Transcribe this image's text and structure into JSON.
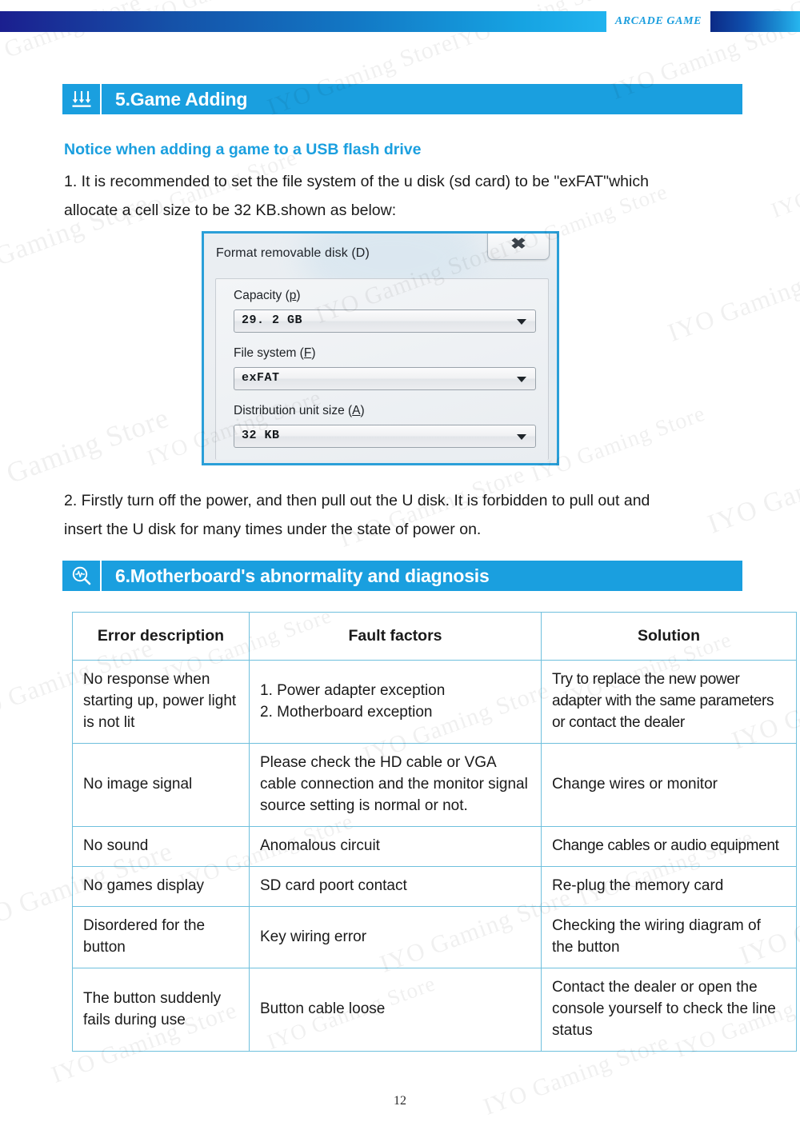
{
  "banner": {
    "label": "ARCADE GAME",
    "accent_color": "#1b9ede",
    "gradient_from": "#1b1f8f",
    "gradient_to": "#27b6ef"
  },
  "sections": [
    {
      "icon": "download-arrows-icon",
      "title": "5.Game Adding"
    },
    {
      "icon": "magnifier-diagnostic-icon",
      "title": "6.Motherboard's abnormality and diagnosis"
    }
  ],
  "section5": {
    "subheading": "Notice when adding a game to a USB flash drive",
    "paragraph1_line1": "1. It is recommended to set the file system of the u disk (sd card) to be \"exFAT\"which",
    "paragraph1_line2": "allocate a cell size to be 32 KB.shown as below:",
    "paragraph2_line1": "2. Firstly turn off the power, and then pull out the U disk. It is forbidden to pull out and",
    "paragraph2_line2": "insert the U disk for many times under the state of power on."
  },
  "format_dialog": {
    "title": "Format removable disk (D)",
    "close_label": "✖",
    "fields": [
      {
        "label": "Capacity (",
        "accel": "p",
        "label_end": ")",
        "value": "29. 2  GB"
      },
      {
        "label": "File system (",
        "accel": "F",
        "label_end": ")",
        "value": "exFAT"
      },
      {
        "label": "Distribution unit size (",
        "accel": "A",
        "label_end": ")",
        "value": "32  KB"
      }
    ],
    "border_color": "#2a9fd8"
  },
  "diagnosis_table": {
    "headers": [
      "Error description",
      "Fault factors",
      "Solution"
    ],
    "border_color": "#6fc0dd",
    "rows": [
      {
        "error": "No response when starting up, power light is not lit",
        "fault": "1. Power adapter exception\n2.  Motherboard exception",
        "solution": "Try to replace the new power adapter with the same parameters or contact the dealer"
      },
      {
        "error": "No image signal",
        "fault": "Please check the HD cable or VGA cable connection and the monitor signal source setting is normal or not.",
        "solution": "Change wires or monitor"
      },
      {
        "error": "No sound",
        "fault": "Anomalous circuit",
        "solution": "Change cables or audio equipment"
      },
      {
        "error": "No games display",
        "fault": "SD card poort contact",
        "solution": "Re-plug the memory card"
      },
      {
        "error": "Disordered for the button",
        "fault": "Key wiring error",
        "solution": "Checking the wiring diagram of the button"
      },
      {
        "error": "The button suddenly fails during use",
        "fault": "Button cable loose",
        "solution": "Contact the dealer or open the console yourself to check the line status"
      }
    ]
  },
  "watermark": {
    "text": "IYO Gaming Store"
  },
  "footer": {
    "page_number": "12"
  }
}
